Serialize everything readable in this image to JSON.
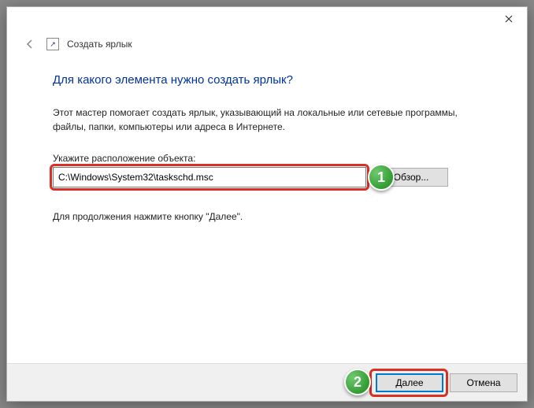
{
  "window": {
    "title": "Создать ярлык"
  },
  "heading": "Для какого элемента нужно создать ярлык?",
  "description": "Этот мастер помогает создать ярлык, указывающий на локальные или сетевые программы, файлы, папки, компьютеры или адреса в Интернете.",
  "field_label": "Укажите расположение объекта:",
  "path_value": "C:\\Windows\\System32\\taskschd.msc",
  "browse_label": "Обзор...",
  "continue_hint": "Для продолжения нажмите кнопку \"Далее\".",
  "buttons": {
    "next": "Далее",
    "cancel": "Отмена"
  },
  "markers": {
    "one": "1",
    "two": "2"
  }
}
